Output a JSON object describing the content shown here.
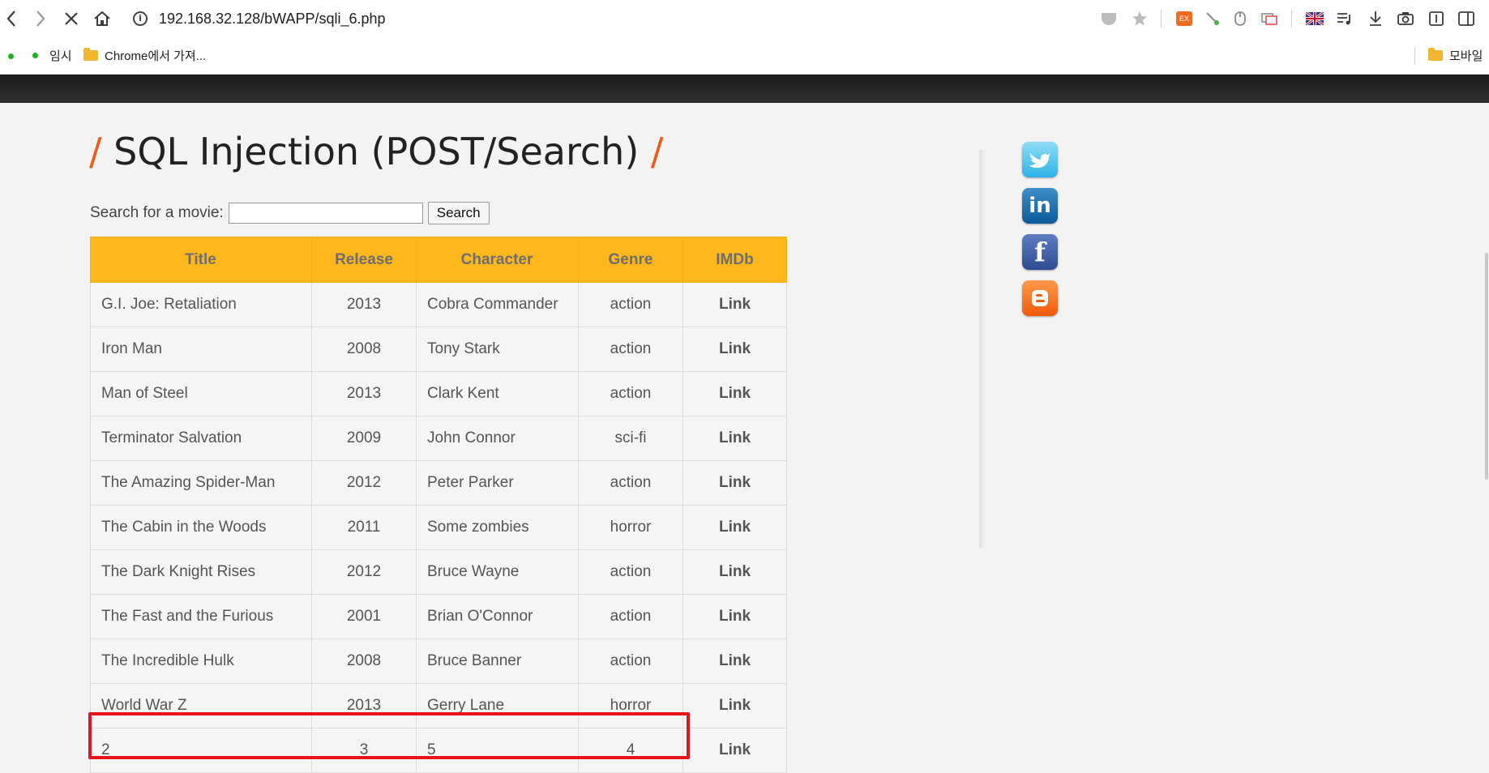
{
  "browser": {
    "url": "192.168.32.128/bWAPP/sqli_6.php",
    "bookmarks": [
      {
        "label": "임시"
      },
      {
        "label": "Chrome에서 가져..."
      },
      {
        "label": "모바일"
      }
    ]
  },
  "page": {
    "title": "SQL Injection (POST/Search)",
    "search_label": "Search for a movie:",
    "search_value": "",
    "search_button": "Search"
  },
  "table": {
    "headers": [
      "Title",
      "Release",
      "Character",
      "Genre",
      "IMDb"
    ],
    "rows": [
      {
        "title": "G.I. Joe: Retaliation",
        "release": "2013",
        "character": "Cobra Commander",
        "genre": "action",
        "imdb": "Link"
      },
      {
        "title": "Iron Man",
        "release": "2008",
        "character": "Tony Stark",
        "genre": "action",
        "imdb": "Link"
      },
      {
        "title": "Man of Steel",
        "release": "2013",
        "character": "Clark Kent",
        "genre": "action",
        "imdb": "Link"
      },
      {
        "title": "Terminator Salvation",
        "release": "2009",
        "character": "John Connor",
        "genre": "sci-fi",
        "imdb": "Link"
      },
      {
        "title": "The Amazing Spider-Man",
        "release": "2012",
        "character": "Peter Parker",
        "genre": "action",
        "imdb": "Link"
      },
      {
        "title": "The Cabin in the Woods",
        "release": "2011",
        "character": "Some zombies",
        "genre": "horror",
        "imdb": "Link"
      },
      {
        "title": "The Dark Knight Rises",
        "release": "2012",
        "character": "Bruce Wayne",
        "genre": "action",
        "imdb": "Link"
      },
      {
        "title": "The Fast and the Furious",
        "release": "2001",
        "character": "Brian O'Connor",
        "genre": "action",
        "imdb": "Link"
      },
      {
        "title": "The Incredible Hulk",
        "release": "2008",
        "character": "Bruce Banner",
        "genre": "action",
        "imdb": "Link"
      },
      {
        "title": "World War Z",
        "release": "2013",
        "character": "Gerry Lane",
        "genre": "horror",
        "imdb": "Link"
      },
      {
        "title": "2",
        "release": "3",
        "character": "5",
        "genre": "4",
        "imdb": "Link"
      }
    ]
  },
  "colors": {
    "accent_slash": "#ee5a1a",
    "table_header": "#ffb71b",
    "highlight_box": "#e8131a"
  },
  "sidebar": {
    "social_icons": [
      "twitter-icon",
      "linkedin-icon",
      "facebook-icon",
      "blogger-icon"
    ]
  }
}
